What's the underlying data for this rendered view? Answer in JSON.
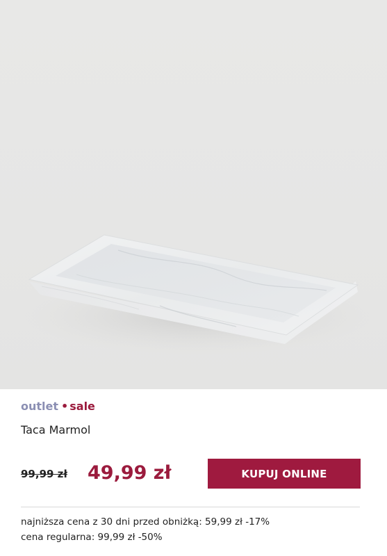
{
  "product": {
    "image_alt": "marble tray",
    "tags": {
      "outlet": "outlet",
      "separator": "•",
      "sale": "sale"
    },
    "name": "Taca Marmol",
    "old_price": "99,99 zł",
    "new_price": "49,99 zł",
    "buy_button_label": "KUPUJ ONLINE",
    "lowest_price_note": "najniższa cena z 30 dni przed obniżką: 59,99 zł -17%",
    "regular_price_note": "cena regularna: 99,99 zł -50%"
  },
  "colors": {
    "accent": "#9f1a3f",
    "outlet_tag": "#8b8fb3",
    "image_background": "#e6e6e5"
  }
}
